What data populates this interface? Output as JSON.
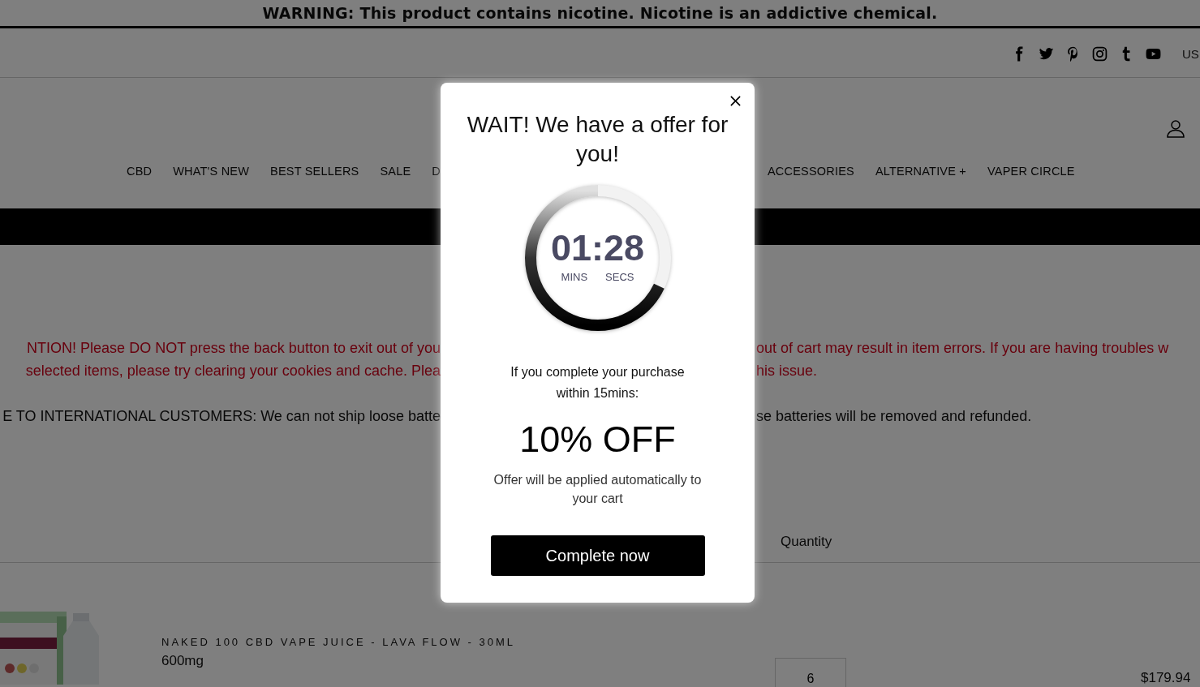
{
  "warning_bar": {
    "text": "WARNING: This product contains nicotine. Nicotine is an addictive chemical."
  },
  "top_bar": {
    "social_links": [
      {
        "kind": "facebook"
      },
      {
        "kind": "twitter"
      },
      {
        "kind": "pinterest"
      },
      {
        "kind": "instagram"
      },
      {
        "kind": "tumblr"
      },
      {
        "kind": "youtube"
      }
    ],
    "currency": "US"
  },
  "nav": {
    "left": [
      "CBD",
      "WHAT'S NEW",
      "BEST SELLERS",
      "SALE",
      "D"
    ],
    "right": [
      "ACCESSORIES",
      "ALTERNATIVE +",
      "VAPER CIRCLE"
    ]
  },
  "notices": [
    {
      "kind": "alert",
      "left": "NTION! Please DO NOT press the back button to exit out of you",
      "right": "out of cart may result in item errors. If you are having troubles w"
    },
    {
      "kind": "alert",
      "left": "selected items, please try clearing your cookies and cache. Plea",
      "right": "his issue."
    },
    {
      "kind": "info",
      "left": "E TO INTERNATIONAL CUSTOMERS: We can not ship loose batte",
      "right": "se batteries will be removed and refunded."
    }
  ],
  "cart_table": {
    "columns": [
      "Quantity"
    ],
    "rows": [
      {
        "title": "NAKED 100 CBD VAPE JUICE - LAVA FLOW - 30ML",
        "variant": "600mg",
        "quantity": "6",
        "price": "$179.94"
      }
    ]
  },
  "popup": {
    "title": "WAIT! We have a offer for you!",
    "timer": {
      "minutes": "01",
      "separator": ":",
      "seconds": "28",
      "minutes_label": "MINS",
      "seconds_label": "SECS",
      "level": 0.68
    },
    "message": "If you complete your purchase within 15mins:",
    "discount": "10% OFF",
    "note": "Offer will be applied automatically to your cart",
    "button": "Complete now"
  }
}
